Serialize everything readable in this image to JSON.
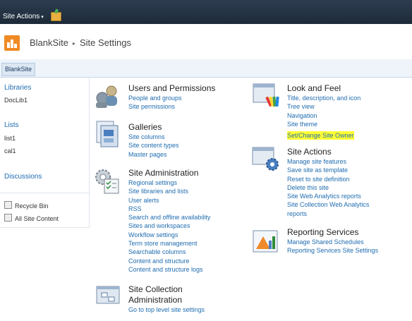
{
  "topbar": {
    "site_actions": "Site Actions",
    "caret": "▾"
  },
  "header": {
    "site_name": "BlankSite",
    "separator": "▸",
    "page_title": "Site Settings"
  },
  "nav": {
    "tab": "BlankSite"
  },
  "leftnav": {
    "libraries": "Libraries",
    "doclib": "DocLib1",
    "lists": "Lists",
    "list1": "list1",
    "cal1": "cal1",
    "discussions": "Discussions",
    "recycle_bin": "Recycle Bin",
    "all_site_content": "All Site Content"
  },
  "sections": {
    "users": {
      "title": "Users and Permissions",
      "links": [
        "People and groups",
        "Site permissions"
      ]
    },
    "galleries": {
      "title": "Galleries",
      "links": [
        "Site columns",
        "Site content types",
        "Master pages"
      ]
    },
    "site_admin": {
      "title": "Site Administration",
      "links": [
        "Regional settings",
        "Site libraries and lists",
        "User alerts",
        "RSS",
        "Search and offline availability",
        "Sites and workspaces",
        "Workflow settings",
        "Term store management",
        "Searchable columns",
        "Content and structure",
        "Content and structure logs"
      ]
    },
    "site_collection_admin": {
      "title_line1": "Site Collection",
      "title_line2": "Administration",
      "links": [
        "Go to top level site settings"
      ]
    },
    "look_feel": {
      "title": "Look and Feel",
      "links": [
        "Title, description, and icon",
        "Tree view",
        "Navigation",
        "Site theme",
        "Set/Change Site Owner"
      ]
    },
    "site_actions": {
      "title": "Site Actions",
      "links": [
        "Manage site features",
        "Save site as template",
        "Reset to site definition",
        "Delete this site",
        "Site Web Analytics reports",
        "Site Collection Web Analytics",
        "reports"
      ]
    },
    "reporting": {
      "title": "Reporting Services",
      "links": [
        "Manage Shared Schedules",
        "Reporting Services Site Settings"
      ]
    }
  },
  "colors": {
    "link": "#1f6cb0",
    "highlight": "#ffff33",
    "topbar": "#2d3d50"
  }
}
